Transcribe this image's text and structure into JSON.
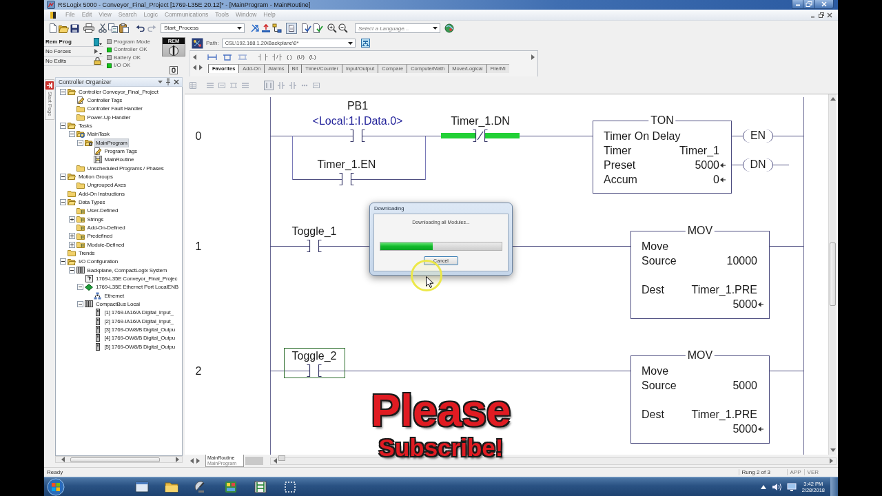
{
  "window": {
    "title": "RSLogix 5000 - Conveyor_Final_Project [1769-L35E 20.12]* - [MainProgram - MainRoutine]"
  },
  "menu": [
    {
      "label": "File",
      "disabled": true
    },
    {
      "label": "Edit",
      "disabled": true
    },
    {
      "label": "View",
      "disabled": true
    },
    {
      "label": "Search",
      "disabled": true
    },
    {
      "label": "Logic",
      "disabled": true
    },
    {
      "label": "Communications",
      "disabled": true
    },
    {
      "label": "Tools",
      "disabled": true
    },
    {
      "label": "Window",
      "disabled": true
    },
    {
      "label": "Help",
      "disabled": true
    }
  ],
  "toolbar": {
    "routine_combo": "Start_Process",
    "language_combo": {
      "placeholder": "Select a Language..."
    }
  },
  "controller_status": {
    "rows": [
      "Rem Prog",
      "No Forces",
      "No Edits"
    ],
    "indicators": [
      {
        "label": "Program Mode",
        "on": false
      },
      {
        "label": "Controller OK",
        "on": true
      },
      {
        "label": "Battery OK",
        "on": false
      },
      {
        "label": "I/O OK",
        "on": true
      }
    ],
    "keyswitch": "REM"
  },
  "path": {
    "label": "Path:",
    "value": "CSL\\192.168.1.20\\Backplane\\0*"
  },
  "instruction_palette": {
    "buttons": [
      "┤ ├",
      "┤/├",
      "( )",
      "(U)",
      "(L)"
    ],
    "tabs": [
      {
        "label": "Favorites",
        "selected": true
      },
      {
        "label": "Add-On",
        "selected": false
      },
      {
        "label": "Alarms",
        "selected": false
      },
      {
        "label": "Bit",
        "selected": false
      },
      {
        "label": "Timer/Counter",
        "selected": false
      },
      {
        "label": "Input/Output",
        "selected": false
      },
      {
        "label": "Compare",
        "selected": false
      },
      {
        "label": "Compute/Math",
        "selected": false
      },
      {
        "label": "Move/Logical",
        "selected": false
      },
      {
        "label": "File/Mi",
        "selected": false
      }
    ]
  },
  "organizer": {
    "side_tab": "Start Page",
    "title": "Controller Organizer",
    "tree": [
      {
        "label": "Controller Conveyor_Final_Project",
        "kind": "folder",
        "selected": false,
        "expanded": true,
        "children": [
          {
            "label": "Controller Tags",
            "kind": "tags",
            "selected": false
          },
          {
            "label": "Controller Fault Handler",
            "kind": "folder",
            "selected": false
          },
          {
            "label": "Power-Up Handler",
            "kind": "folder",
            "selected": false
          }
        ]
      },
      {
        "label": "Tasks",
        "kind": "folder",
        "selected": false,
        "expanded": true,
        "children": [
          {
            "label": "MainTask",
            "kind": "task",
            "selected": false,
            "expanded": true,
            "children": [
              {
                "label": "MainProgram",
                "kind": "program",
                "selected": true,
                "expanded": true,
                "children": [
                  {
                    "label": "Program Tags",
                    "kind": "tags",
                    "selected": false
                  },
                  {
                    "label": "MainRoutine",
                    "kind": "routine",
                    "selected": false
                  }
                ]
              }
            ]
          },
          {
            "label": "Unscheduled Programs / Phases",
            "kind": "folder",
            "selected": false
          }
        ]
      },
      {
        "label": "Motion Groups",
        "kind": "folder",
        "selected": false,
        "expanded": true,
        "children": [
          {
            "label": "Ungrouped Axes",
            "kind": "folder",
            "selected": false
          }
        ]
      },
      {
        "label": "Add-On Instructions",
        "kind": "folder",
        "selected": false
      },
      {
        "label": "Data Types",
        "kind": "folder",
        "selected": false,
        "expanded": true,
        "children": [
          {
            "label": "User-Defined",
            "kind": "type-folder",
            "selected": false
          },
          {
            "label": "Strings",
            "kind": "type-folder",
            "selected": false,
            "expanded": false
          },
          {
            "label": "Add-On-Defined",
            "kind": "type-folder",
            "selected": false
          },
          {
            "label": "Predefined",
            "kind": "type-folder",
            "selected": false,
            "expanded": false
          },
          {
            "label": "Module-Defined",
            "kind": "type-folder",
            "selected": false,
            "expanded": false
          }
        ]
      },
      {
        "label": "Trends",
        "kind": "folder",
        "selected": false
      },
      {
        "label": "I/O Configuration",
        "kind": "folder",
        "selected": false,
        "expanded": true,
        "children": [
          {
            "label": "Backplane, CompactLogix System",
            "kind": "rack",
            "selected": false,
            "expanded": true,
            "children": [
              {
                "label": "1769-L35E Conveyor_Final_Projec",
                "kind": "controller",
                "selected": false
              },
              {
                "label": "1769-L35E Ethernet Port LocalENB",
                "kind": "ethernet-port",
                "selected": false,
                "expanded": true,
                "children": [
                  {
                    "label": "Ethernet",
                    "kind": "network",
                    "selected": false
                  }
                ]
              },
              {
                "label": "CompactBus Local",
                "kind": "rack",
                "selected": false,
                "expanded": true,
                "children": [
                  {
                    "label": "[1] 1769-IA16/A Digital_Input_",
                    "kind": "io-module",
                    "selected": false
                  },
                  {
                    "label": "[2] 1769-IA16/A Digital_Input_",
                    "kind": "io-module",
                    "selected": false
                  },
                  {
                    "label": "[3] 1769-OW8/B Digital_Outpu",
                    "kind": "io-module",
                    "selected": false
                  },
                  {
                    "label": "[4] 1769-OW8/B Digital_Outpu",
                    "kind": "io-module",
                    "selected": false
                  },
                  {
                    "label": "[5] 1769-OW8/B Digital_Outpu",
                    "kind": "io-module",
                    "selected": false
                  }
                ]
              }
            ]
          }
        ]
      }
    ]
  },
  "ladder": {
    "rungs": [
      {
        "number": "0",
        "series": [
          {
            "kind": "xic",
            "tag": "PB1",
            "alias": "<Local:1:I.Data.0>",
            "energized": false,
            "selected": false,
            "parallel": [
              {
                "kind": "xic",
                "tag": "Timer_1.EN",
                "energized": false,
                "selected": false
              }
            ]
          },
          {
            "kind": "xio",
            "tag": "Timer_1.DN",
            "energized": true,
            "selected": false
          }
        ],
        "output": {
          "kind": "ton",
          "mnemonic": "TON",
          "title": "Timer On Delay",
          "fields": [
            {
              "label": "Timer",
              "value": "Timer_1",
              "arrow": false
            },
            {
              "label": "Preset",
              "value": "5000",
              "arrow": true
            },
            {
              "label": "Accum",
              "value": "0",
              "arrow": true
            }
          ],
          "bits": [
            "EN",
            "DN"
          ]
        }
      },
      {
        "number": "1",
        "series": [
          {
            "kind": "xic",
            "tag": "Toggle_1",
            "energized": false,
            "selected": false
          }
        ],
        "output": {
          "kind": "mov",
          "mnemonic": "MOV",
          "title": "Move",
          "fields": [
            {
              "label": "Source",
              "value": "10000",
              "arrow": false
            },
            {
              "label": "Dest",
              "value": "Timer_1.PRE",
              "arrow": false,
              "live": {
                "value": "5000",
                "arrow": true
              }
            }
          ]
        }
      },
      {
        "number": "2",
        "series": [
          {
            "kind": "xic",
            "tag": "Toggle_2",
            "energized": false,
            "selected": true
          }
        ],
        "output": {
          "kind": "mov",
          "mnemonic": "MOV",
          "title": "Move",
          "fields": [
            {
              "label": "Source",
              "value": "5000",
              "arrow": false
            },
            {
              "label": "Dest",
              "value": "Timer_1.PRE",
              "arrow": false,
              "live": {
                "value": "5000",
                "arrow": true
              }
            }
          ]
        }
      }
    ]
  },
  "routine_tabs": [
    {
      "title": "MainRoutine",
      "program": "MainProgram",
      "selected": true
    }
  ],
  "dialog": {
    "title": "Downloading",
    "message": "Downloading all Modules...",
    "progress": {
      "level": 0.43
    },
    "button": "Cancel"
  },
  "overlay": {
    "lines": [
      "Please",
      "Subscribe!"
    ]
  },
  "status_bar": {
    "message": "Ready",
    "rung": "Rung 2 of 3",
    "panels": [
      "APP",
      "VER"
    ]
  },
  "taskbar": {
    "time": "3:42 PM",
    "date": "2/28/2018"
  }
}
